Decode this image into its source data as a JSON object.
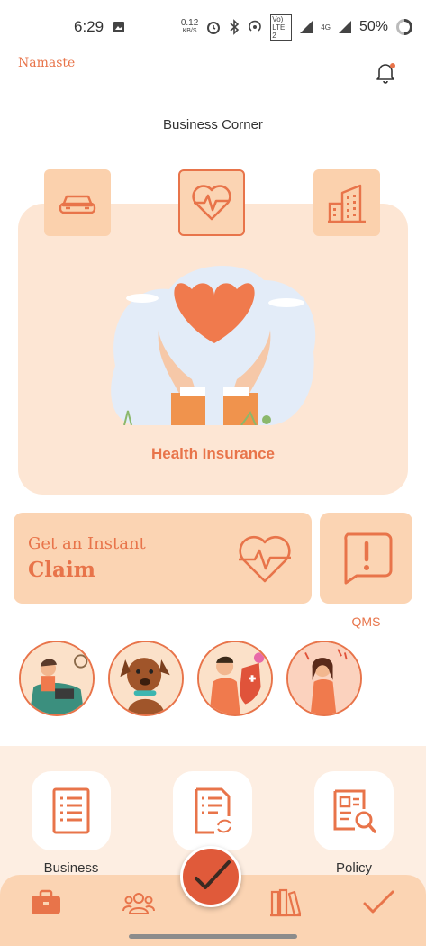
{
  "status_bar": {
    "time": "6:29",
    "net_speed_value": "0.12",
    "net_speed_unit": "KB/S",
    "lte_label": "Vo) LTE 2",
    "signal_label": "4G",
    "battery": "50%"
  },
  "header": {
    "greeting": "Namaste",
    "title": "Business Corner"
  },
  "categories": {
    "items": [
      "car-icon",
      "heart-pulse-icon",
      "building-icon"
    ],
    "active": "heart-pulse-icon",
    "hero_label": "Health Insurance"
  },
  "claim": {
    "line1": "Get an Instant",
    "line2": "Claim"
  },
  "qms": {
    "label": "QMS"
  },
  "stories": [
    "person-laptop-story",
    "dog-story",
    "man-shield-story",
    "woman-alert-story"
  ],
  "quick_actions": [
    {
      "label": "Business",
      "icon": "document-list-icon"
    },
    {
      "label": "",
      "icon": "document-renew-icon"
    },
    {
      "label": "Policy",
      "icon": "policy-search-icon"
    }
  ],
  "bottom_nav": {
    "items": [
      "briefcase-icon",
      "users-icon",
      "check-fab-icon",
      "books-icon",
      "check-icon"
    ]
  },
  "colors": {
    "accent": "#e8744a",
    "card_bg": "#fde6d4",
    "tile_bg": "#fbd4b3",
    "fab": "#e05a3a"
  }
}
